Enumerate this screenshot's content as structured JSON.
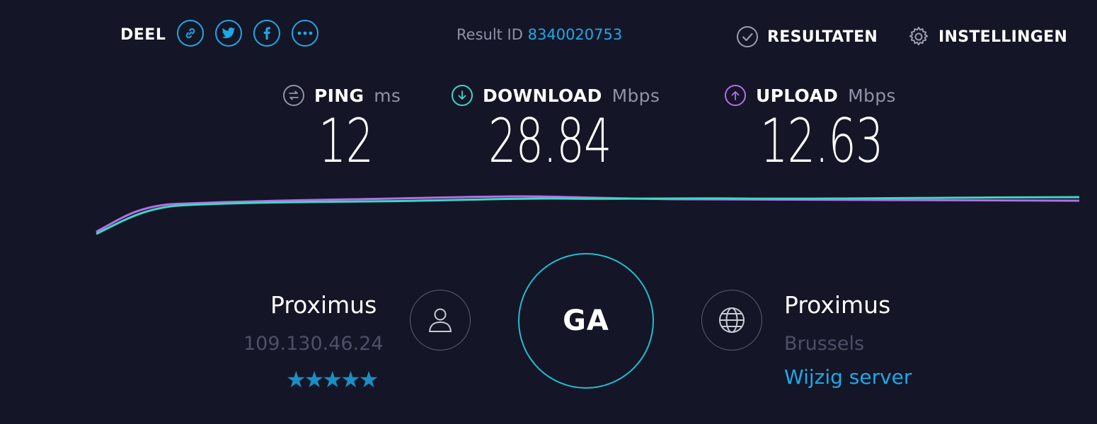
{
  "share": {
    "label": "DEEL",
    "icons": [
      "link-icon",
      "twitter-icon",
      "facebook-icon",
      "more-icon"
    ]
  },
  "result": {
    "label": "Result ID",
    "id": "8340020753"
  },
  "nav": {
    "results_label": "RESULTATEN",
    "settings_label": "INSTELLINGEN"
  },
  "metrics": {
    "ping": {
      "label": "PING",
      "unit": "ms",
      "value": "12"
    },
    "download": {
      "label": "DOWNLOAD",
      "unit": "Mbps",
      "value": "28.84"
    },
    "upload": {
      "label": "UPLOAD",
      "unit": "Mbps",
      "value": "12.63"
    }
  },
  "client": {
    "isp": "Proximus",
    "ip": "109.130.46.24",
    "stars": "★★★★★",
    "rating": 5
  },
  "go": {
    "label": "GA"
  },
  "server": {
    "name": "Proximus",
    "location": "Brussels",
    "change_label": "Wijzig server"
  },
  "colors": {
    "background": "#141526",
    "accent": "#1fa8e6",
    "download": "#3fd6c8",
    "upload": "#b46ee6"
  }
}
